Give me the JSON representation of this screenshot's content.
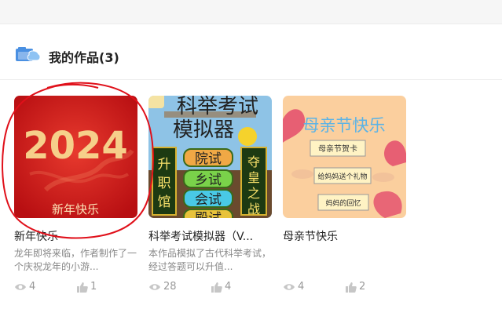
{
  "section": {
    "title": "我的作品(3)",
    "icon": "works-folder-icon"
  },
  "works": [
    {
      "title": "新年快乐",
      "desc": "龙年即将来临，作者制作了一个庆祝龙年的小游...",
      "views": "4",
      "likes": "1",
      "thumb": {
        "year": "2024",
        "caption": "新年快乐",
        "bg": "#d32020"
      }
    },
    {
      "title": "科举考试模拟器（V...",
      "desc": "本作品模拟了古代科举考试，经过答题可以升值...",
      "views": "28",
      "likes": "4",
      "thumb": {
        "heading": "科举考试",
        "heading2": "模拟器",
        "buttons": [
          "院试",
          "乡试",
          "会试",
          "殿试"
        ],
        "left_sign": "升职馆",
        "right_sign": "夺皇之战"
      }
    },
    {
      "title": "母亲节快乐",
      "desc": "",
      "views": "4",
      "likes": "2",
      "thumb": {
        "heading": "母亲节快乐",
        "labels": [
          "母亲节贺卡",
          "给妈妈送个礼物",
          "妈妈的回忆"
        ],
        "bg": "#fbcf9e"
      }
    }
  ],
  "colors": {
    "annotation": "#e0101a",
    "accent": "#4a90e2"
  }
}
